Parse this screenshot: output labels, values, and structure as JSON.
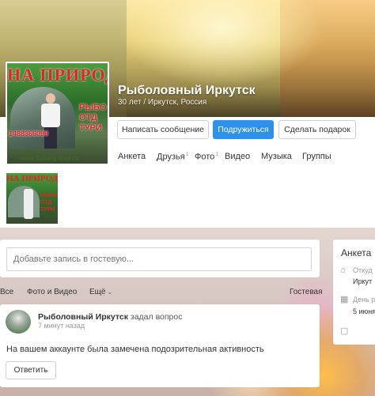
{
  "profile": {
    "name": "Рыболовный Иркутск",
    "subtitle": "30 лет / Иркутск, Россия",
    "avatar": {
      "banner": "НА ПРИРОДЕ",
      "side_text": "РЫБО ОТД ТУРИ",
      "phone": "1488366099",
      "site": "www.fishing-tour.ru"
    }
  },
  "actions": {
    "message": "Написать сообщение",
    "subscribe": "Подружиться",
    "gift": "Сделать подарок"
  },
  "tabs": [
    {
      "label": "Анкета",
      "count": ""
    },
    {
      "label": "Друзья",
      "count": "1"
    },
    {
      "label": "Фото",
      "count": "1"
    },
    {
      "label": "Видео",
      "count": ""
    },
    {
      "label": "Музыка",
      "count": ""
    },
    {
      "label": "Группы",
      "count": ""
    }
  ],
  "guestbook": {
    "placeholder": "Добавьте запись в гостевую..."
  },
  "filters": {
    "all": "Все",
    "photo_video": "Фото и Видео",
    "more": "Ещё",
    "guestbook": "Гостевая"
  },
  "sidebar": {
    "title": "Анкета",
    "from_label": "Откуд",
    "from_value": "Иркут",
    "birthday_label": "День р",
    "birthday_value": "5 июня"
  },
  "post": {
    "author": "Рыболовный Иркутск",
    "action": "задал вопрос",
    "time": "7 минут назад",
    "text": "На вашем аккаунте была замечена подозрительная активность",
    "reply": "Ответить"
  },
  "colors": {
    "accent": "#2d91ec",
    "avatar_text": "#e32424"
  }
}
